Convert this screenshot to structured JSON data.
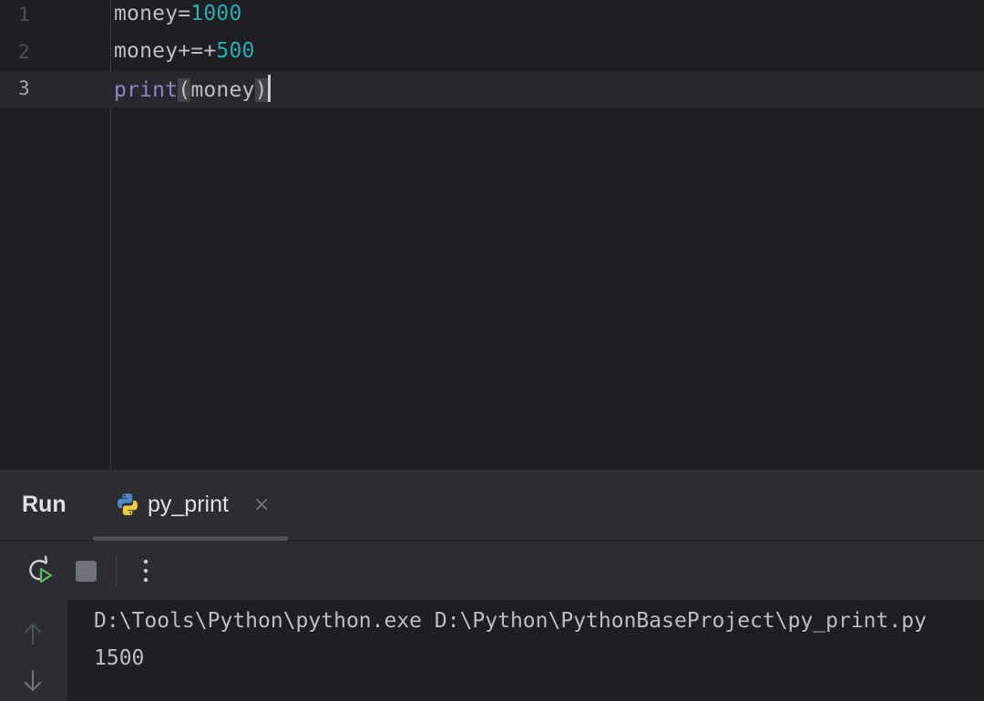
{
  "editor": {
    "lines": [
      {
        "number": "1",
        "tokens": [
          {
            "text": "money=",
            "kind": "id"
          },
          {
            "text": "1000",
            "kind": "num"
          }
        ]
      },
      {
        "number": "2",
        "tokens": [
          {
            "text": "money+=+",
            "kind": "id"
          },
          {
            "text": "500",
            "kind": "num"
          }
        ]
      },
      {
        "number": "3",
        "tokens": [
          {
            "text": "print",
            "kind": "fn"
          },
          {
            "text": "(",
            "kind": "brace"
          },
          {
            "text": "money",
            "kind": "id"
          },
          {
            "text": ")",
            "kind": "brace"
          }
        ]
      }
    ],
    "current_line": "3"
  },
  "run_panel": {
    "title": "Run",
    "tab": {
      "label": "py_print",
      "close": "×",
      "icon": "python-icon"
    },
    "toolbar": {
      "rerun_icon": "rerun-icon",
      "stop_icon": "stop-icon",
      "more_icon": "more-vertical-icon"
    },
    "console": {
      "command": "D:\\Tools\\Python\\python.exe D:\\Python\\PythonBaseProject\\py_print.py",
      "output": "1500"
    }
  },
  "colors": {
    "editor_bg": "#1e1f22",
    "panel_bg": "#2b2d30",
    "number": "#2aacb8",
    "builtin": "#8888c6",
    "text": "#bcbec4"
  }
}
